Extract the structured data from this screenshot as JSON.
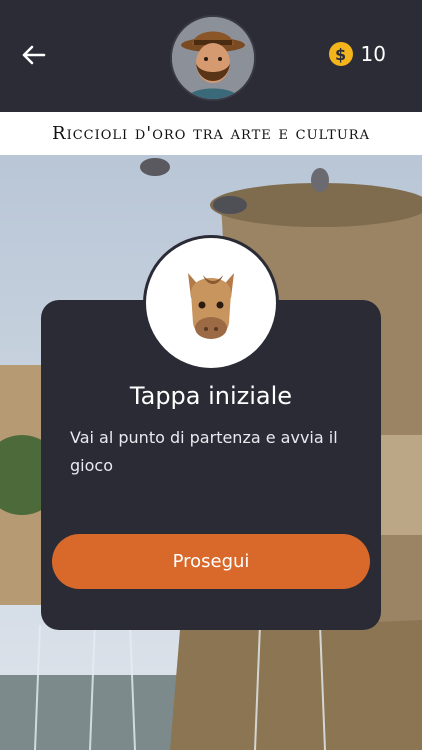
{
  "header": {
    "back_icon": "arrow-left-icon",
    "coins_icon": "dollar-coin-icon",
    "coins_count": "10",
    "title": "Riccioli d'oro tra arte e cultura",
    "accent": "#f3b51b"
  },
  "modal": {
    "title": "Tappa iniziale",
    "text": "Vai al punto di partenza e avvia il gioco",
    "button_label": "Prosegui",
    "button_color": "#d9692a",
    "badge_icon": "horse-head-icon"
  }
}
